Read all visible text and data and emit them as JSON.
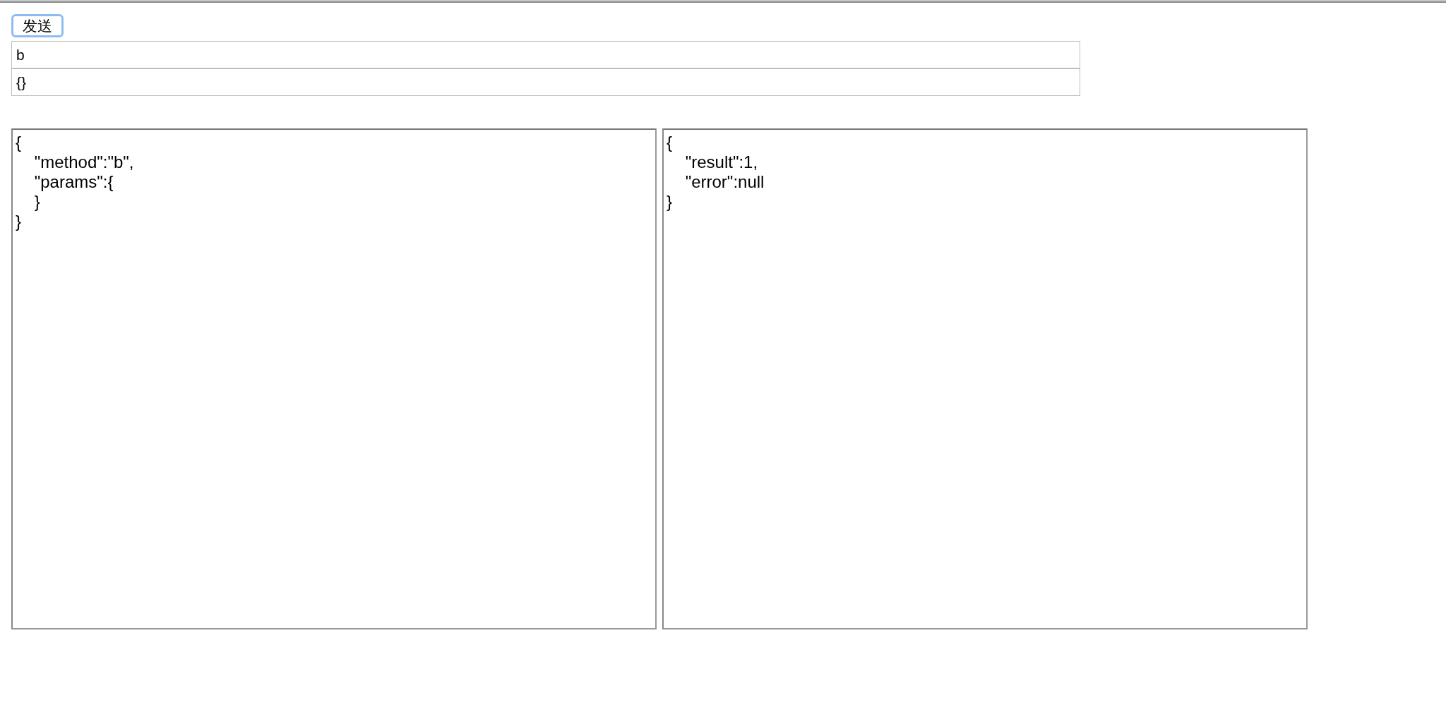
{
  "send_button": {
    "label": "发送",
    "focused": true
  },
  "method_field": {
    "value": "b"
  },
  "params_field": {
    "value": "{}"
  },
  "request_area": {
    "value": "{\n    \"method\":\"b\",\n    \"params\":{\n    }\n}"
  },
  "response_area": {
    "value": "{\n    \"result\":1,\n    \"error\":null\n}"
  }
}
